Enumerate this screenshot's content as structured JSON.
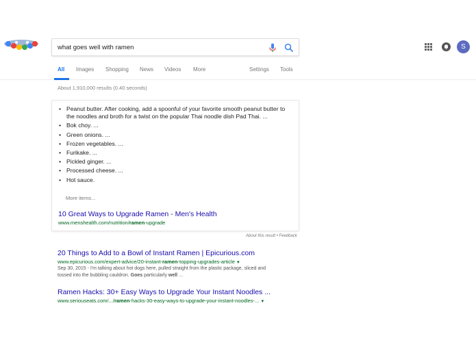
{
  "search": {
    "query": "what goes well with ramen"
  },
  "header": {
    "avatar_letter": "S"
  },
  "tabs": [
    {
      "label": "All",
      "active": true
    },
    {
      "label": "Images"
    },
    {
      "label": "Shopping"
    },
    {
      "label": "News"
    },
    {
      "label": "Videos"
    },
    {
      "label": "More"
    },
    {
      "label": "Settings"
    },
    {
      "label": "Tools"
    }
  ],
  "stats": "About 1,910,000 results (0.40 seconds)",
  "snippet": {
    "items": [
      "Peanut butter. After cooking, add a spoonful of your favorite smooth peanut butter to the noodles and broth for a twist on the popular Thai noodle dish Pad Thai. ...",
      "Bok choy. ...",
      "Green onions. ...",
      "Frozen vegetables. ...",
      "Furikake. ...",
      "Pickled ginger. ...",
      "Processed cheese. ...",
      "Hot sauce."
    ],
    "more_items": "More items...",
    "title": "10 Great Ways to Upgrade Ramen - Men's Health",
    "url_prefix": "www.menshealth.com/nutrition/",
    "url_bold": "ramen",
    "url_suffix": "-upgrade",
    "about": "About this result • Feedback"
  },
  "results": [
    {
      "title": "20 Things to Add to a Bowl of Instant Ramen | Epicurious.com",
      "url_prefix": "www.epicurious.com/expert-advice/20-instant-",
      "url_bold": "ramen",
      "url_suffix": "-topping-upgrades-article",
      "snippet_line1": "Sep 30, 2015 - I'm talking about hot dogs here, pulled straight from the plastic package, sliced and",
      "snippet_line2_a": "tossed into the bubbling cauldron. ",
      "snippet_line2_b1": "Goes",
      "snippet_line2_c": " particularly ",
      "snippet_line2_b2": "well",
      "snippet_line2_d": " ..."
    },
    {
      "title": "Ramen Hacks: 30+ Easy Ways to Upgrade Your Instant Noodles ...",
      "url_prefix": "www.seriouseats.com/.../",
      "url_bold": "ramen",
      "url_suffix": "-hacks-30-easy-ways-to-upgrade-your-instant-noodles-..."
    }
  ],
  "colors": {
    "link": "#1a0dab",
    "url": "#006621",
    "accent": "#1a73e8",
    "avatar": "#5c6bc0"
  }
}
